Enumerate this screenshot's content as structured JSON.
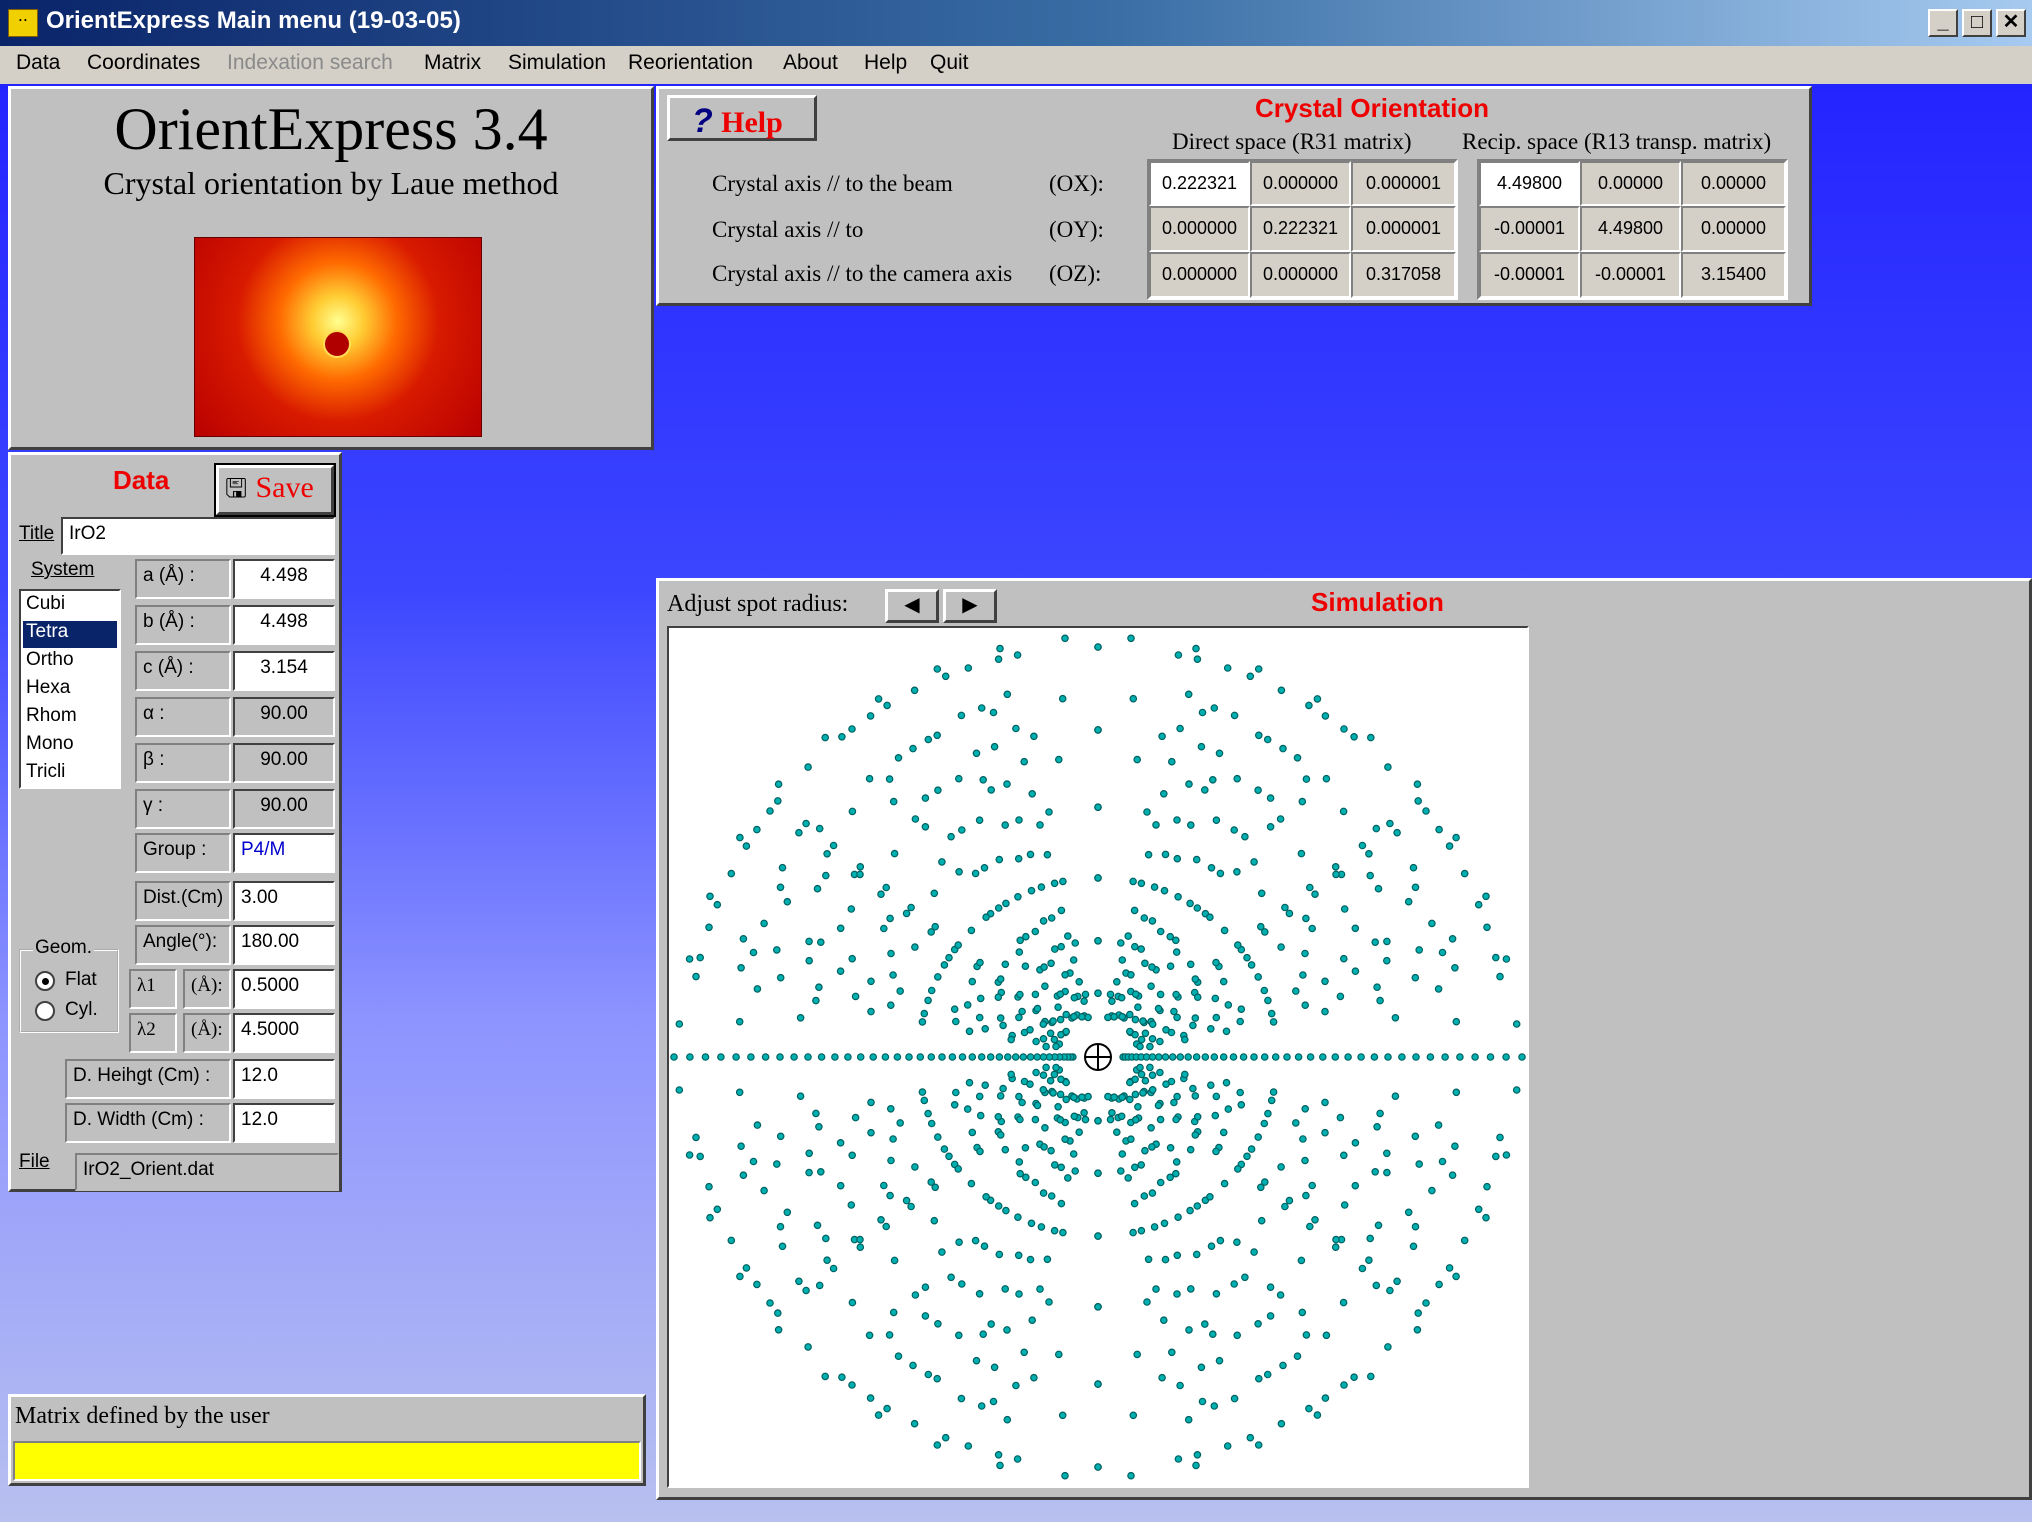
{
  "window": {
    "title": "OrientExpress Main menu (19-03-05)",
    "icon": "app-dots-icon",
    "controls": [
      "minimize-icon",
      "maximize-icon",
      "close-icon"
    ]
  },
  "menu": [
    "Data",
    "Coordinates",
    "Indexation search",
    "Matrix",
    "Simulation",
    "Reorientation",
    "About",
    "Help",
    "Quit"
  ],
  "menu_disabled": "Indexation search",
  "splash": {
    "title": "OrientExpress 3.4",
    "subtitle": "Crystal orientation by Laue method"
  },
  "orientation": {
    "title": "Crystal Orientation",
    "help_label": "Help",
    "direct_header": "Direct space (R31 matrix)",
    "recip_header": "Recip. space (R13 transp. matrix)",
    "rows": [
      {
        "label": "Crystal axis // to the beam",
        "axis": "(OX):",
        "direct": [
          "0.222321",
          "0.000000",
          "0.000001"
        ],
        "recip": [
          "4.49800",
          "0.00000",
          "0.00000"
        ]
      },
      {
        "label": "Crystal axis // to",
        "axis": "(OY):",
        "direct": [
          "0.000000",
          "0.222321",
          "0.000001"
        ],
        "recip": [
          "-0.00001",
          "4.49800",
          "0.00000"
        ]
      },
      {
        "label": "Crystal axis // to the camera axis",
        "axis": "(OZ):",
        "direct": [
          "0.000000",
          "0.000000",
          "0.317058"
        ],
        "recip": [
          "-0.00001",
          "-0.00001",
          "3.15400"
        ]
      }
    ]
  },
  "data_panel": {
    "title": "Data",
    "save_label": "Save",
    "title_label": "Title",
    "title_value": "IrO2",
    "system_label": "System",
    "systems": [
      "Cubi",
      "Tetra",
      "Ortho",
      "Hexa",
      "Rhom",
      "Mono",
      "Tricli"
    ],
    "selected_system": "Tetra",
    "params": [
      {
        "label": "a (Å) :",
        "value": "4.498"
      },
      {
        "label": "b (Å) :",
        "value": "4.498"
      },
      {
        "label": "c (Å) :",
        "value": "3.154"
      },
      {
        "label": "α :",
        "value": "90.00"
      },
      {
        "label": "β :",
        "value": "90.00"
      },
      {
        "label": "γ :",
        "value": "90.00"
      }
    ],
    "group_label": "Group :",
    "group_value": "P4/M",
    "dist_label": "Dist.(Cm)",
    "dist_value": "3.00",
    "angle_label": "Angle(°):",
    "angle_value": "180.00",
    "geom_label": "Geom.",
    "geom_options": [
      "Flat",
      "Cyl."
    ],
    "geom_selected": "Flat",
    "lambda1_label": "λ1",
    "lambda2_label": "λ2",
    "lambda_unit": "(Å):",
    "lambda1_value": "0.5000",
    "lambda2_value": "4.5000",
    "dheight_label": "D. Heihgt  (Cm) :",
    "dheight_value": "12.0",
    "dwidth_label": "D. Width (Cm) :",
    "dwidth_value": "12.0",
    "file_label": "File",
    "file_value": "IrO2_Orient.dat"
  },
  "simulation": {
    "title": "Simulation",
    "adjust_label": "Adjust spot radius:",
    "left_arrow": "arrow-left-icon",
    "right_arrow": "arrow-right-icon",
    "center_marker": "beam-center-crosshair-icon"
  },
  "status": {
    "text": "Matrix defined by the user",
    "bar_color": "#ffff00"
  },
  "colors": {
    "accent_red": "#ee0000",
    "spot": "#00b0b0",
    "desktop_top": "#2424ff",
    "selection": "#0a246a"
  }
}
